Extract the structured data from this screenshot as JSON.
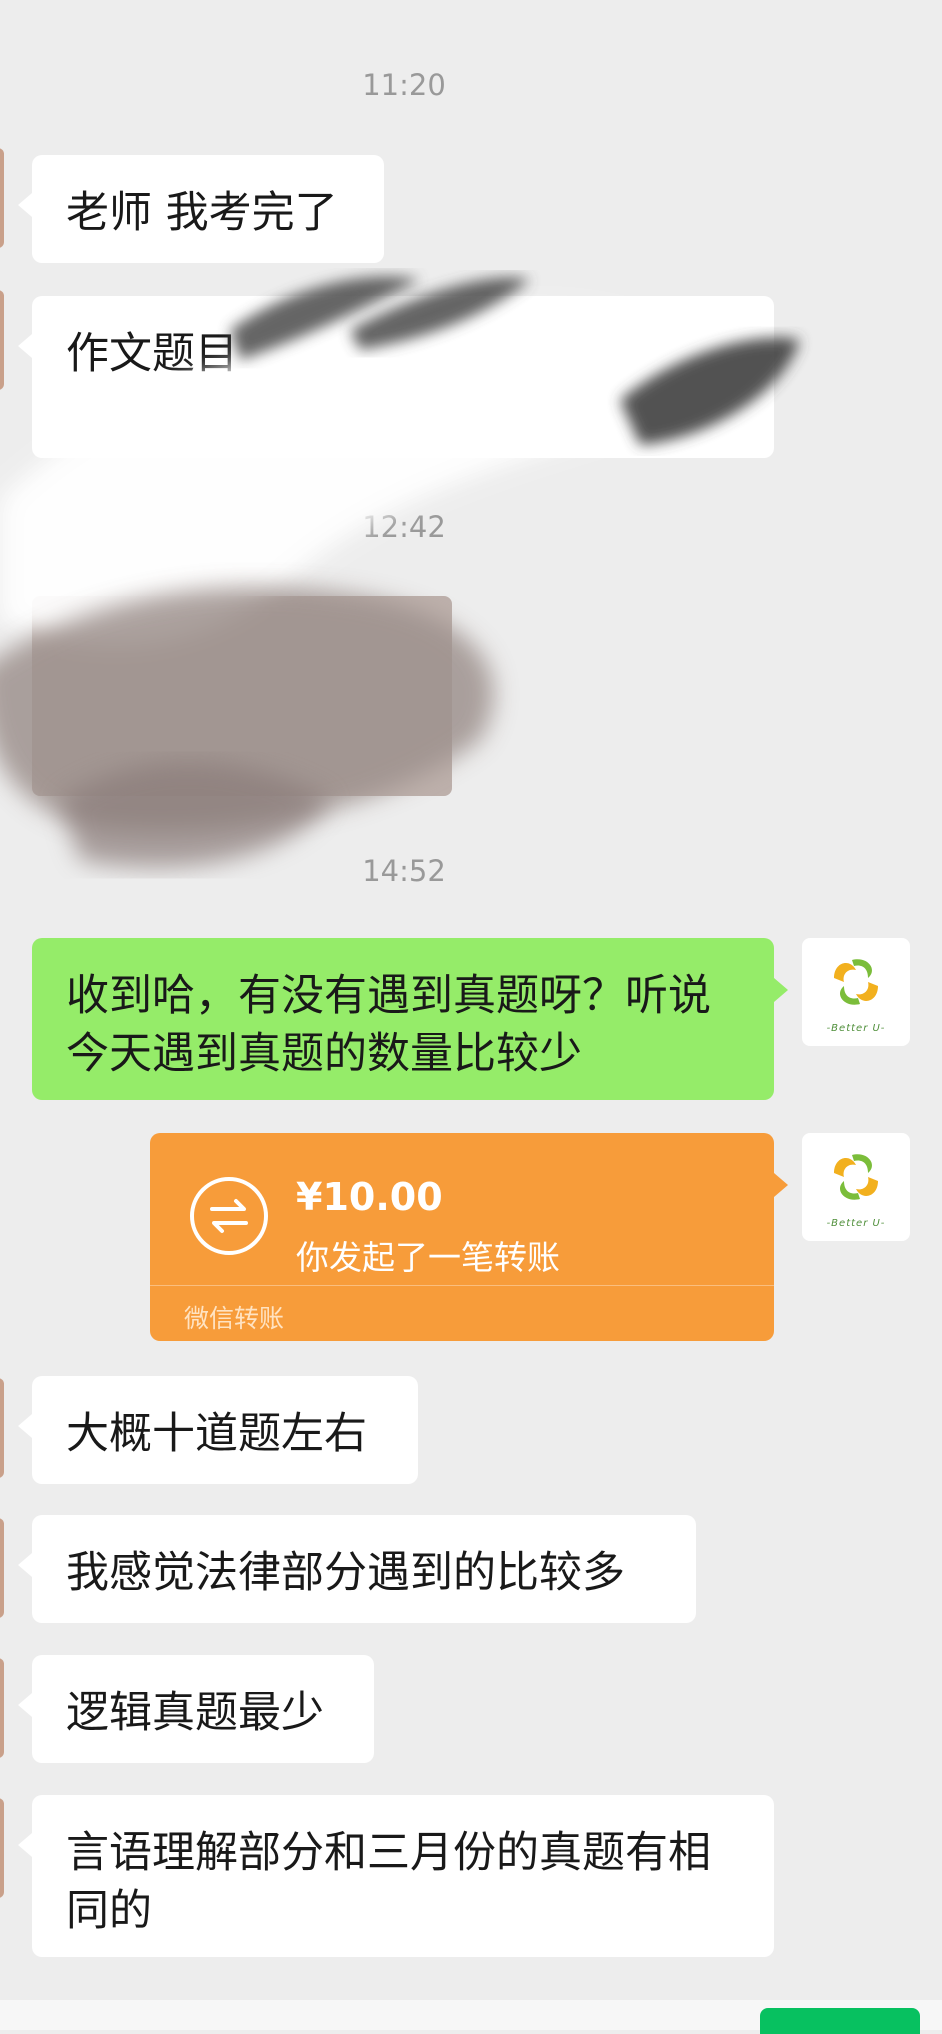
{
  "timestamps": [
    "11:20",
    "12:42",
    "14:52"
  ],
  "messages": {
    "m1": "老师 我考完了",
    "m2": "作文题目",
    "m3": "收到哈，有没有遇到真题呀？听说今天遇到真题的数量比较少",
    "m4": "大概十道题左右",
    "m5": "我感觉法律部分遇到的比较多",
    "m6": "逻辑真题最少",
    "m7": "言语理解部分和三月份的真题有相同的"
  },
  "transfer": {
    "amount": "¥10.00",
    "description": "你发起了一笔转账",
    "footer": "微信转账"
  },
  "avatar_brand": "-Better U-",
  "colors": {
    "background": "#ededed",
    "incoming_bubble": "#ffffff",
    "outgoing_bubble": "#95ec69",
    "transfer_card": "#f79c3a"
  }
}
